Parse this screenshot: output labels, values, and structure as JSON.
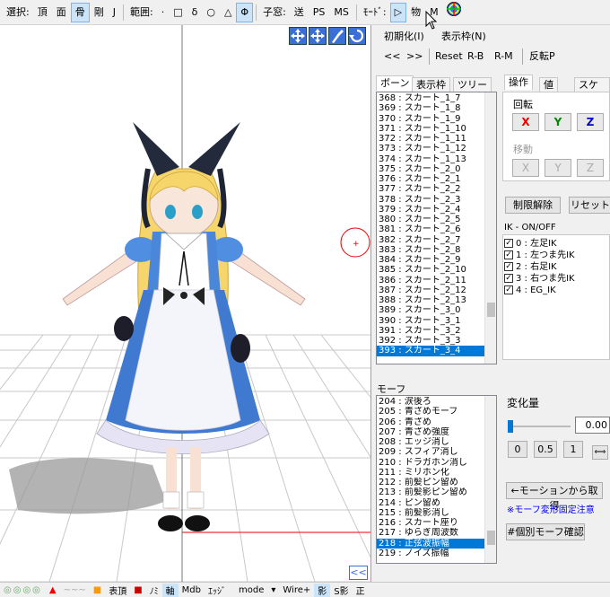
{
  "toolbar": {
    "select_label": "選択:",
    "sel_vertex": "頂",
    "sel_face": "面",
    "sel_bone": "骨",
    "sel_rigid": "剛",
    "sel_joint": "J",
    "range_label": "範囲:",
    "range_dot": "·",
    "range_rect": "□",
    "range_delta": "δ",
    "range_circle": "○",
    "range_tri": "△",
    "range_phi": "Φ",
    "window_label": "子窓:",
    "window_send": "送",
    "window_ps": "PS",
    "window_ms": "MS",
    "mode_label": "ﾓｰﾄﾞ:",
    "mode_play": "▷",
    "mode_physics": "物",
    "mode_m": "M"
  },
  "right_top": {
    "init_label": "初期化(I)",
    "display_frame_label": "表示枠(N)",
    "prev": "<<",
    "next": ">>",
    "reset": "Reset",
    "rb": "R-B",
    "rm": "R-M",
    "flip": "反転P"
  },
  "bone_tabs": [
    "ボーン",
    "表示枠",
    "ツリー"
  ],
  "bone_list": [
    "368 : スカート_1_7",
    "369 : スカート_1_8",
    "370 : スカート_1_9",
    "371 : スカート_1_10",
    "372 : スカート_1_11",
    "373 : スカート_1_12",
    "374 : スカート_1_13",
    "375 : スカート_2_0",
    "376 : スカート_2_1",
    "377 : スカート_2_2",
    "378 : スカート_2_3",
    "379 : スカート_2_4",
    "380 : スカート_2_5",
    "381 : スカート_2_6",
    "382 : スカート_2_7",
    "383 : スカート_2_8",
    "384 : スカート_2_9",
    "385 : スカート_2_10",
    "386 : スカート_2_11",
    "387 : スカート_2_12",
    "388 : スカート_2_13",
    "389 : スカート_3_0",
    "390 : スカート_3_1",
    "391 : スカート_3_2",
    "392 : スカート_3_3",
    "393 : スカート_3_4"
  ],
  "bone_selected_index": 25,
  "op_tabs": [
    "操作",
    "値",
    "スケール"
  ],
  "rotate_label": "回転",
  "move_label": "移動",
  "axis_x": "X",
  "axis_y": "Y",
  "axis_z": "Z",
  "limit_release": "制限解除",
  "reset_btn": "リセット",
  "ik_label": "IK - ON/OFF",
  "ik_items": [
    "0 : 左足IK",
    "1 : 左つま先IK",
    "2 : 右足IK",
    "3 : 右つま先IK",
    "4 : EG_IK"
  ],
  "morph_label": "モーフ",
  "morph_list": [
    "204 : 涙後ろ",
    "205 : 青ざめモーフ",
    "206 : 青ざめ",
    "207 : 青ざめ強度",
    "208 : エッジ消し",
    "209 : スフィア消し",
    "210 : ドラガホン消し",
    "211 : ミリホン化",
    "212 : 前髪ピン留め",
    "213 : 前髪影ピン留め",
    "214 : ピン留め",
    "215 : 前髪影消し",
    "216 : スカート座り",
    "217 : ゆらぎ周波数",
    "218 : 正弦波振幅",
    "219 : ノイズ振幅"
  ],
  "morph_selected_index": 14,
  "change_label": "変化量",
  "change_value": "0.00",
  "change_level": 0.0,
  "preset_0": "0",
  "preset_05": "0.5",
  "preset_1": "1",
  "get_from_motion": "←モーションから取得",
  "morph_note": "※モーフ変形固定注意",
  "individual_morph": "#個別モーフ確認",
  "collapse": "<<",
  "status": {
    "vertex_top": "表頂",
    "edge_mark": "ﾉﾐ",
    "axis": "軸",
    "mdb": "Mdb",
    "edge": "ｴｯｼﾞ",
    "mode": "mode",
    "wire": "Wire+",
    "shadow": "影",
    "sshadow": "S影",
    "front": "正"
  },
  "colors": {
    "selection": "#0078d7",
    "axis_red": "#ff0000",
    "axis_green": "#00a000",
    "axis_blue": "#0000ff",
    "note_blue": "#0000ff"
  }
}
